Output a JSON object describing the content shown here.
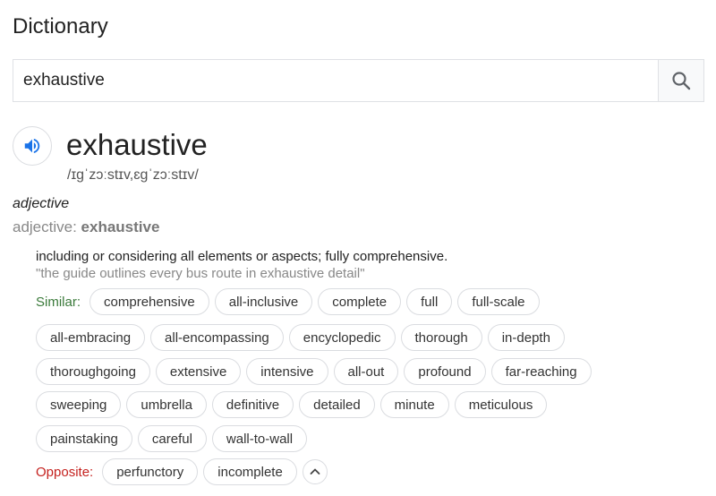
{
  "header": {
    "title": "Dictionary"
  },
  "search": {
    "value": "exhaustive"
  },
  "entry": {
    "word": "exhaustive",
    "phonetic": "/ɪɡˈzɔːstɪv,ɛɡˈzɔːstɪv/",
    "pos_italic": "adjective",
    "pos_label": "adjective: ",
    "pos_word": "exhaustive",
    "definition": "including or considering all elements or aspects; fully comprehensive.",
    "example": "\"the guide outlines every bus route in exhaustive detail\""
  },
  "similar": {
    "label": "Similar:",
    "rows": [
      [
        "comprehensive",
        "all-inclusive",
        "complete",
        "full",
        "full-scale"
      ],
      [
        "all-embracing",
        "all-encompassing",
        "encyclopedic",
        "thorough",
        "in-depth"
      ],
      [
        "thoroughgoing",
        "extensive",
        "intensive",
        "all-out",
        "profound",
        "far-reaching"
      ],
      [
        "sweeping",
        "umbrella",
        "definitive",
        "detailed",
        "minute",
        "meticulous"
      ],
      [
        "painstaking",
        "careful",
        "wall-to-wall"
      ]
    ]
  },
  "opposite": {
    "label": "Opposite:",
    "items": [
      "perfunctory",
      "incomplete"
    ]
  },
  "colors": {
    "similar_label": "#3a7a3a",
    "opposite_label": "#c5221f",
    "speaker_icon": "#1a73e8"
  },
  "icons": {
    "search": "search-icon",
    "speaker": "speaker-icon",
    "collapse": "chevron-up-icon"
  }
}
